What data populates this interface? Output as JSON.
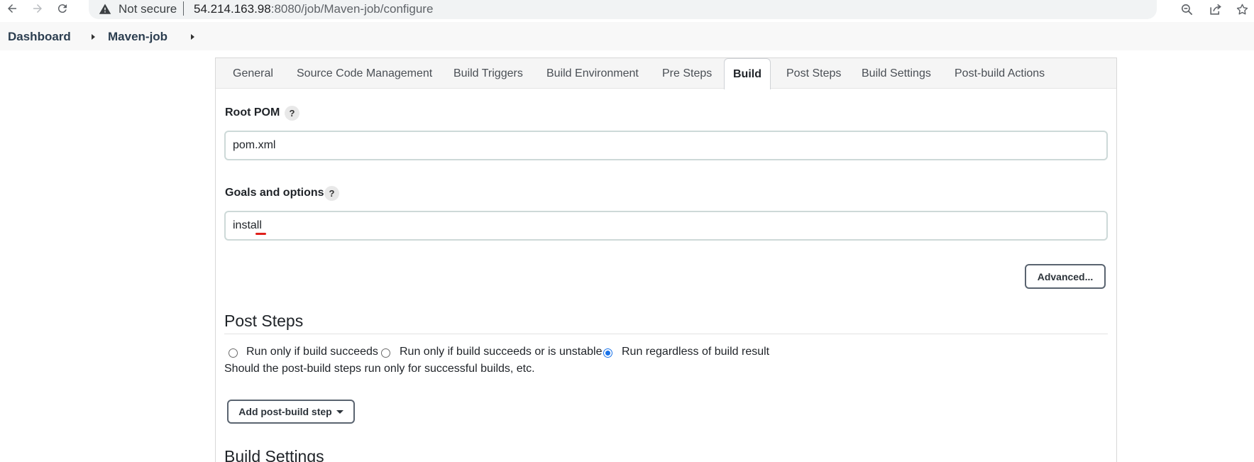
{
  "browser": {
    "security_label": "Not secure",
    "url_host": "54.214.163.98",
    "url_rest": ":8080/job/Maven-job/configure"
  },
  "breadcrumb": {
    "items": [
      "Dashboard",
      "Maven-job"
    ]
  },
  "tabs": [
    {
      "label": "General"
    },
    {
      "label": "Source Code Management"
    },
    {
      "label": "Build Triggers"
    },
    {
      "label": "Build Environment"
    },
    {
      "label": "Pre Steps"
    },
    {
      "label": "Build",
      "active": true
    },
    {
      "label": "Post Steps"
    },
    {
      "label": "Build Settings"
    },
    {
      "label": "Post-build Actions"
    }
  ],
  "build": {
    "root_pom_label": "Root POM",
    "root_pom_value": "pom.xml",
    "goals_label": "Goals and options",
    "goals_value": "install",
    "help_glyph": "?",
    "advanced_label": "Advanced..."
  },
  "post_steps": {
    "title": "Post Steps",
    "options": [
      {
        "label": "Run only if build succeeds",
        "checked": false
      },
      {
        "label": "Run only if build succeeds or is unstable",
        "checked": false
      },
      {
        "label": "Run regardless of build result",
        "checked": true
      }
    ],
    "description": "Should the post-build steps run only for successful builds, etc.",
    "add_step_label": "Add post-build step"
  },
  "build_settings": {
    "title": "Build Settings"
  },
  "colors": {
    "accent": "#1a73e8",
    "spellcheck": "#e0201b"
  }
}
